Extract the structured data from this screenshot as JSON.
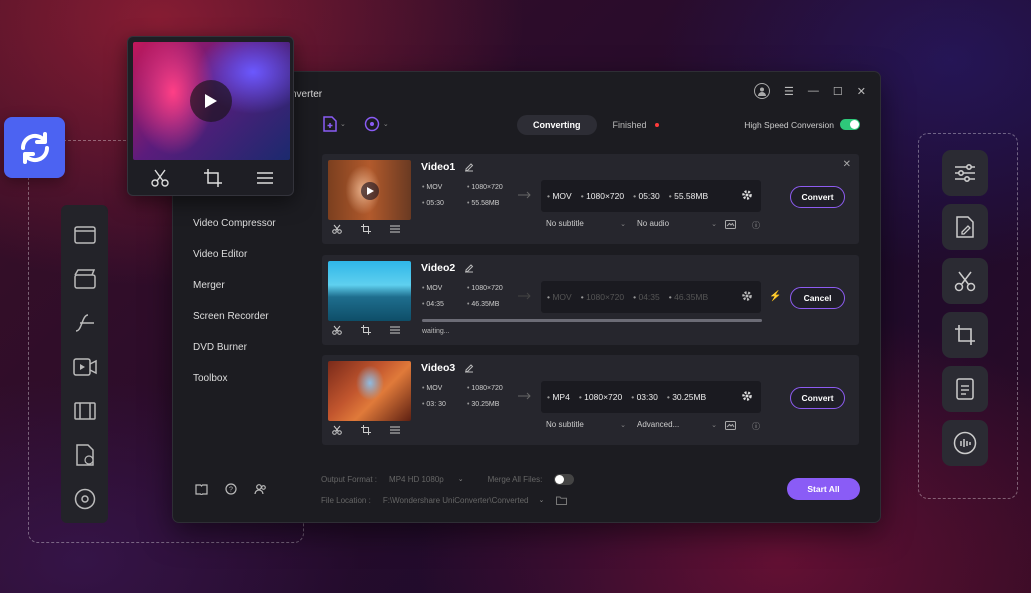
{
  "app": {
    "title": "nverter"
  },
  "tabs": {
    "converting": "Converting",
    "finished": "Finished"
  },
  "high_speed": {
    "label": "High Speed Conversion",
    "on": true
  },
  "sidenav": [
    "Video Compressor",
    "Video Editor",
    "Merger",
    "Screen Recorder",
    "DVD Burner",
    "Toolbox"
  ],
  "videos": [
    {
      "name": "Video1",
      "src_format": "MOV",
      "src_res": "1080×720",
      "src_dur": "05:30",
      "src_size": "55.58MB",
      "tgt_format": "MOV",
      "tgt_res": "1080×720",
      "tgt_dur": "05:30",
      "tgt_size": "55.58MB",
      "subtitle": "No subtitle",
      "audio": "No audio",
      "action": "Convert"
    },
    {
      "name": "Video2",
      "src_format": "MOV",
      "src_res": "1080×720",
      "src_dur": "04:35",
      "src_size": "46.35MB",
      "tgt_format": "MOV",
      "tgt_res": "1080×720",
      "tgt_dur": "04:35",
      "tgt_size": "46.35MB",
      "status": "waiting...",
      "action": "Cancel"
    },
    {
      "name": "Video3",
      "src_format": "MOV",
      "src_res": "1080×720",
      "src_dur": "03: 30",
      "src_size": "30.25MB",
      "tgt_format": "MP4",
      "tgt_res": "1080×720",
      "tgt_dur": "03:30",
      "tgt_size": "30.25MB",
      "subtitle": "No subtitle",
      "audio": "Advanced...",
      "action": "Convert"
    }
  ],
  "footer": {
    "output_label": "Output Format :",
    "output_value": "MP4 HD 1080p",
    "merge_label": "Merge All Files:",
    "merge_on": false,
    "location_label": "File Location :",
    "location_value": "F:\\Wondershare UniConverter\\Converted",
    "start_all": "Start All"
  },
  "colors": {
    "accent": "#8a5cf6",
    "logo": "#4c63f2",
    "toggle_on": "#2ec87a",
    "bolt": "#f5b400"
  }
}
